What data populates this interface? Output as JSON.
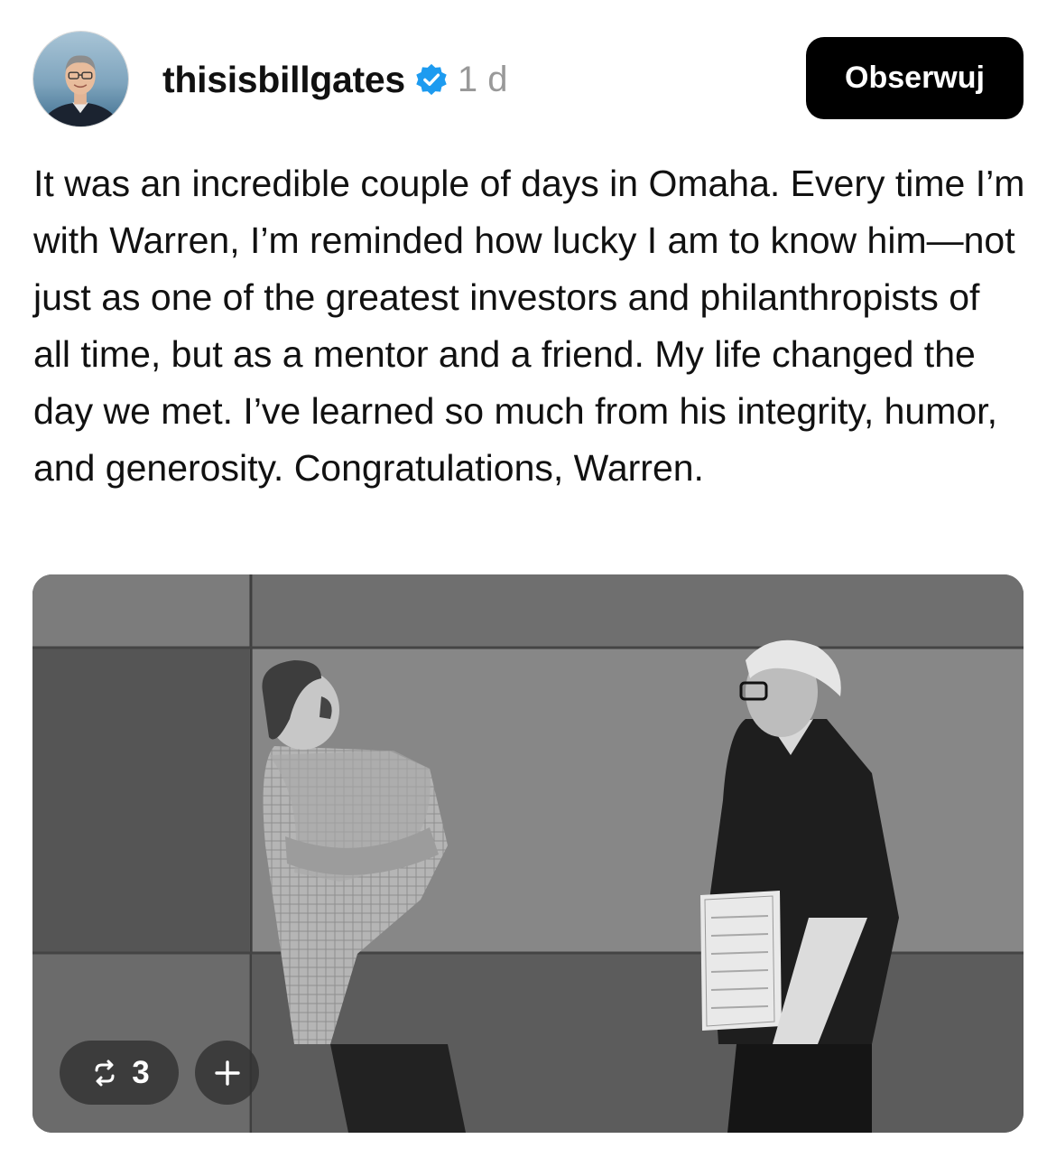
{
  "post": {
    "author": {
      "username": "thisisbillgates",
      "verified_icon": "verified-badge-icon",
      "time": "1 d"
    },
    "follow_label": "Obserwuj",
    "text": "It was an incredible couple of days in Omaha. Every time I’m with Warren, I’m reminded how lucky I am to know him—not just as one of the greatest investors and philanthropists of all time, but as a mentor and a friend. My life changed the day we met. I’ve learned so much from his integrity, humor, and generosity. Congratulations, Warren.",
    "media": {
      "repost_count": "3",
      "repost_icon": "repost-icon",
      "add_icon": "plus-icon"
    },
    "colors": {
      "verified": "#1d9bf0",
      "button_bg": "#000000",
      "time": "#999999"
    }
  }
}
